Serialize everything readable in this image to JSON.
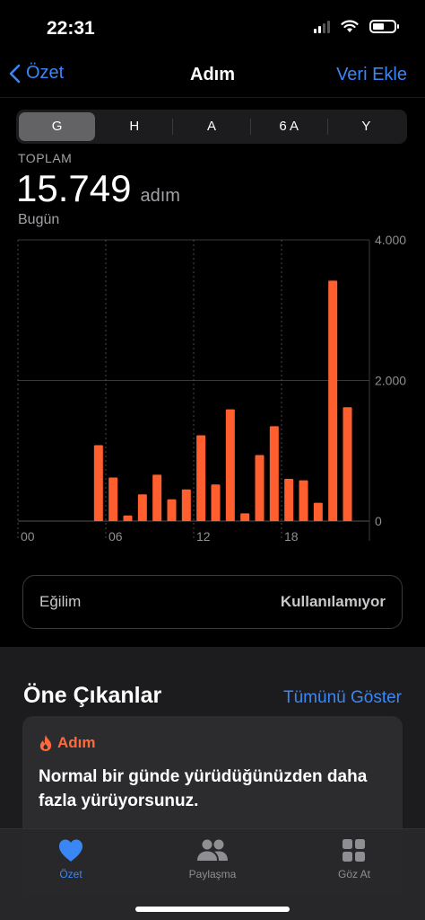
{
  "status": {
    "time": "22:31"
  },
  "nav": {
    "back_label": "Özet",
    "title": "Adım",
    "action_label": "Veri Ekle"
  },
  "segments": [
    "G",
    "H",
    "A",
    "6 A",
    "Y"
  ],
  "selected_segment": "G",
  "summary": {
    "label": "TOPLAM",
    "value": "15.749",
    "unit": "adım",
    "date": "Bugün"
  },
  "chart_data": {
    "type": "bar",
    "x_tick_labels": [
      "00",
      "06",
      "12",
      "18"
    ],
    "y_tick_labels": [
      "4.000",
      "2.000",
      "0"
    ],
    "ylim": [
      0,
      4000
    ],
    "bar_color": "#ff5f2e",
    "categories": [
      "05",
      "06",
      "07",
      "08",
      "09",
      "10",
      "11",
      "12",
      "13",
      "14",
      "15",
      "16",
      "17",
      "18",
      "19",
      "20",
      "21",
      "22"
    ],
    "values": [
      1080,
      620,
      80,
      380,
      660,
      310,
      450,
      1220,
      520,
      1590,
      110,
      940,
      1350,
      600,
      580,
      260,
      3420,
      1620
    ]
  },
  "trend": {
    "label": "Eğilim",
    "value": "Kullanılamıyor"
  },
  "highlights": {
    "title": "Öne Çıkanlar",
    "link": "Tümünü Göster",
    "card": {
      "category": "Adım",
      "text": "Normal bir günde yürüdüğünüzden daha fazla yürüyorsunuz."
    }
  },
  "tabbar": {
    "tabs": [
      {
        "label": "Özet"
      },
      {
        "label": "Paylaşma"
      },
      {
        "label": "Göz At"
      }
    ]
  },
  "colors": {
    "accent": "#3a86f5",
    "highlight": "#ff6a3d"
  }
}
